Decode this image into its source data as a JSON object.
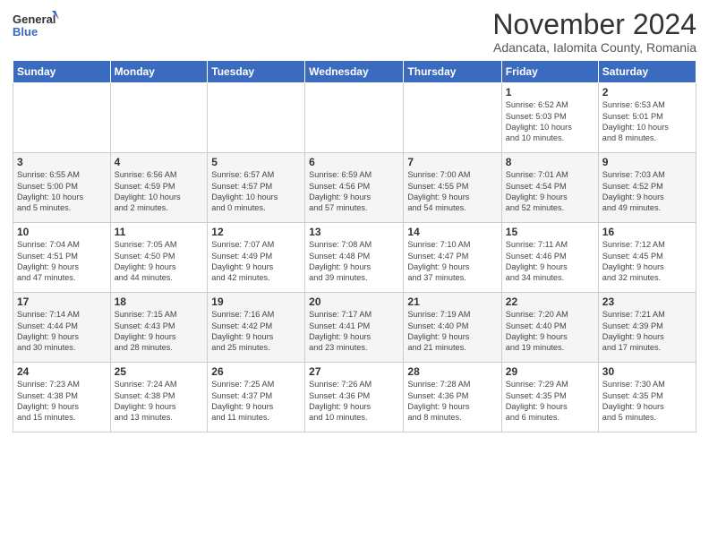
{
  "logo": {
    "general": "General",
    "blue": "Blue"
  },
  "title": "November 2024",
  "location": "Adancata, Ialomita County, Romania",
  "weekdays": [
    "Sunday",
    "Monday",
    "Tuesday",
    "Wednesday",
    "Thursday",
    "Friday",
    "Saturday"
  ],
  "weeks": [
    [
      {
        "day": "",
        "info": ""
      },
      {
        "day": "",
        "info": ""
      },
      {
        "day": "",
        "info": ""
      },
      {
        "day": "",
        "info": ""
      },
      {
        "day": "",
        "info": ""
      },
      {
        "day": "1",
        "info": "Sunrise: 6:52 AM\nSunset: 5:03 PM\nDaylight: 10 hours\nand 10 minutes."
      },
      {
        "day": "2",
        "info": "Sunrise: 6:53 AM\nSunset: 5:01 PM\nDaylight: 10 hours\nand 8 minutes."
      }
    ],
    [
      {
        "day": "3",
        "info": "Sunrise: 6:55 AM\nSunset: 5:00 PM\nDaylight: 10 hours\nand 5 minutes."
      },
      {
        "day": "4",
        "info": "Sunrise: 6:56 AM\nSunset: 4:59 PM\nDaylight: 10 hours\nand 2 minutes."
      },
      {
        "day": "5",
        "info": "Sunrise: 6:57 AM\nSunset: 4:57 PM\nDaylight: 10 hours\nand 0 minutes."
      },
      {
        "day": "6",
        "info": "Sunrise: 6:59 AM\nSunset: 4:56 PM\nDaylight: 9 hours\nand 57 minutes."
      },
      {
        "day": "7",
        "info": "Sunrise: 7:00 AM\nSunset: 4:55 PM\nDaylight: 9 hours\nand 54 minutes."
      },
      {
        "day": "8",
        "info": "Sunrise: 7:01 AM\nSunset: 4:54 PM\nDaylight: 9 hours\nand 52 minutes."
      },
      {
        "day": "9",
        "info": "Sunrise: 7:03 AM\nSunset: 4:52 PM\nDaylight: 9 hours\nand 49 minutes."
      }
    ],
    [
      {
        "day": "10",
        "info": "Sunrise: 7:04 AM\nSunset: 4:51 PM\nDaylight: 9 hours\nand 47 minutes."
      },
      {
        "day": "11",
        "info": "Sunrise: 7:05 AM\nSunset: 4:50 PM\nDaylight: 9 hours\nand 44 minutes."
      },
      {
        "day": "12",
        "info": "Sunrise: 7:07 AM\nSunset: 4:49 PM\nDaylight: 9 hours\nand 42 minutes."
      },
      {
        "day": "13",
        "info": "Sunrise: 7:08 AM\nSunset: 4:48 PM\nDaylight: 9 hours\nand 39 minutes."
      },
      {
        "day": "14",
        "info": "Sunrise: 7:10 AM\nSunset: 4:47 PM\nDaylight: 9 hours\nand 37 minutes."
      },
      {
        "day": "15",
        "info": "Sunrise: 7:11 AM\nSunset: 4:46 PM\nDaylight: 9 hours\nand 34 minutes."
      },
      {
        "day": "16",
        "info": "Sunrise: 7:12 AM\nSunset: 4:45 PM\nDaylight: 9 hours\nand 32 minutes."
      }
    ],
    [
      {
        "day": "17",
        "info": "Sunrise: 7:14 AM\nSunset: 4:44 PM\nDaylight: 9 hours\nand 30 minutes."
      },
      {
        "day": "18",
        "info": "Sunrise: 7:15 AM\nSunset: 4:43 PM\nDaylight: 9 hours\nand 28 minutes."
      },
      {
        "day": "19",
        "info": "Sunrise: 7:16 AM\nSunset: 4:42 PM\nDaylight: 9 hours\nand 25 minutes."
      },
      {
        "day": "20",
        "info": "Sunrise: 7:17 AM\nSunset: 4:41 PM\nDaylight: 9 hours\nand 23 minutes."
      },
      {
        "day": "21",
        "info": "Sunrise: 7:19 AM\nSunset: 4:40 PM\nDaylight: 9 hours\nand 21 minutes."
      },
      {
        "day": "22",
        "info": "Sunrise: 7:20 AM\nSunset: 4:40 PM\nDaylight: 9 hours\nand 19 minutes."
      },
      {
        "day": "23",
        "info": "Sunrise: 7:21 AM\nSunset: 4:39 PM\nDaylight: 9 hours\nand 17 minutes."
      }
    ],
    [
      {
        "day": "24",
        "info": "Sunrise: 7:23 AM\nSunset: 4:38 PM\nDaylight: 9 hours\nand 15 minutes."
      },
      {
        "day": "25",
        "info": "Sunrise: 7:24 AM\nSunset: 4:38 PM\nDaylight: 9 hours\nand 13 minutes."
      },
      {
        "day": "26",
        "info": "Sunrise: 7:25 AM\nSunset: 4:37 PM\nDaylight: 9 hours\nand 11 minutes."
      },
      {
        "day": "27",
        "info": "Sunrise: 7:26 AM\nSunset: 4:36 PM\nDaylight: 9 hours\nand 10 minutes."
      },
      {
        "day": "28",
        "info": "Sunrise: 7:28 AM\nSunset: 4:36 PM\nDaylight: 9 hours\nand 8 minutes."
      },
      {
        "day": "29",
        "info": "Sunrise: 7:29 AM\nSunset: 4:35 PM\nDaylight: 9 hours\nand 6 minutes."
      },
      {
        "day": "30",
        "info": "Sunrise: 7:30 AM\nSunset: 4:35 PM\nDaylight: 9 hours\nand 5 minutes."
      }
    ]
  ]
}
